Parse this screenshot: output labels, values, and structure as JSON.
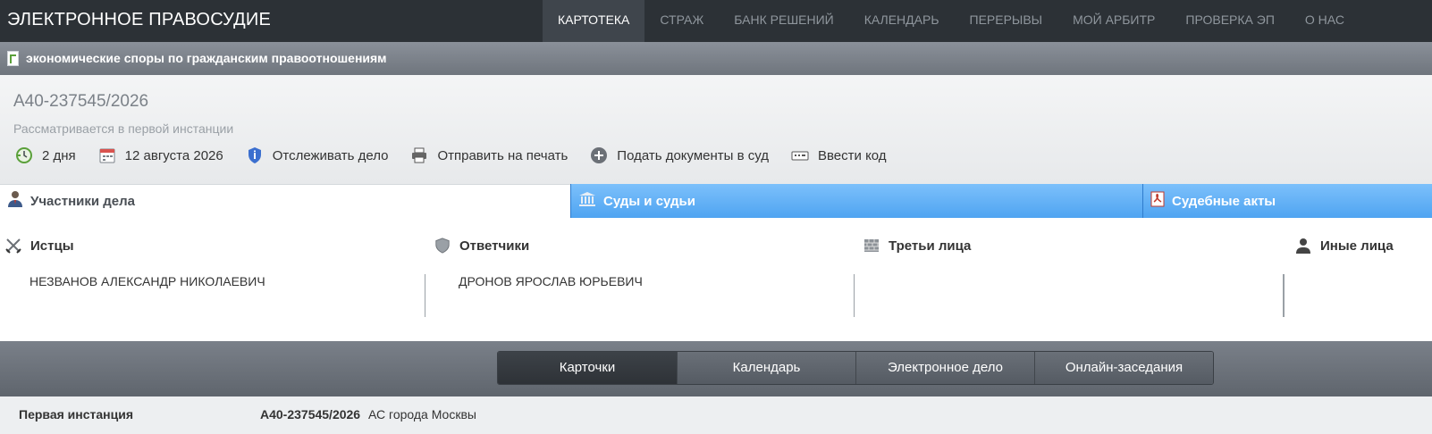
{
  "app": {
    "brand": "ЭЛЕКТРОННОЕ ПРАВОСУДИЕ"
  },
  "nav": {
    "items": [
      {
        "label": "КАРТОТЕКА",
        "active": true
      },
      {
        "label": "СТРАЖ",
        "active": false
      },
      {
        "label": "БАНК РЕШЕНИЙ",
        "active": false
      },
      {
        "label": "КАЛЕНДАРЬ",
        "active": false
      },
      {
        "label": "ПЕРЕРЫВЫ",
        "active": false
      },
      {
        "label": "МОЙ АРБИТР",
        "active": false
      },
      {
        "label": "ПРОВЕРКА ЭП",
        "active": false
      },
      {
        "label": "О НАС",
        "active": false
      }
    ]
  },
  "category": {
    "icon": "document-icon",
    "label": "экономические споры по гражданским правоотношениям"
  },
  "case": {
    "number": "А40-237545/2026",
    "status": "Рассматривается в первой инстанции",
    "actions": [
      {
        "icon": "clock-icon",
        "label": "2 дня"
      },
      {
        "icon": "calendar-icon",
        "label": "12 августа 2026"
      },
      {
        "icon": "shield-track-icon",
        "label": "Отслеживать дело"
      },
      {
        "icon": "printer-icon",
        "label": "Отправить на печать"
      },
      {
        "icon": "plus-circle-icon",
        "label": "Подать документы в суд"
      },
      {
        "icon": "keyboard-icon",
        "label": "Ввести код"
      }
    ]
  },
  "participant_tabs": [
    {
      "icon": "person-icon",
      "label": "Участники дела",
      "active": true
    },
    {
      "icon": "courthouse-icon",
      "label": "Суды и судьи",
      "active": false
    },
    {
      "icon": "pdf-icon",
      "label": "Судебные акты",
      "active": false
    }
  ],
  "participants": {
    "plaintiffs": {
      "icon": "crossed-swords-icon",
      "label": "Истцы",
      "items": [
        "НЕЗВАНОВ АЛЕКСАНДР НИКОЛАЕВИЧ"
      ]
    },
    "defendants": {
      "icon": "shield-icon",
      "label": "Ответчики",
      "items": [
        "ДРОНОВ ЯРОСЛАВ ЮРЬЕВИЧ"
      ]
    },
    "third_parties": {
      "icon": "wall-icon",
      "label": "Третьи лица",
      "items": []
    },
    "others": {
      "icon": "user-icon",
      "label": "Иные лица",
      "items": []
    }
  },
  "bottom_tabs": [
    {
      "label": "Карточки",
      "active": true
    },
    {
      "label": "Календарь",
      "active": false
    },
    {
      "label": "Электронное дело",
      "active": false
    },
    {
      "label": "Онлайн-заседания",
      "active": false
    }
  ],
  "instance": {
    "label": "Первая инстанция",
    "case_number": "А40-237545/2026",
    "court": "АС города Москвы"
  },
  "colors": {
    "topbar": "#2c3136",
    "tab_blue": "#5aa9f4",
    "accent_green": "#5aa03a"
  }
}
